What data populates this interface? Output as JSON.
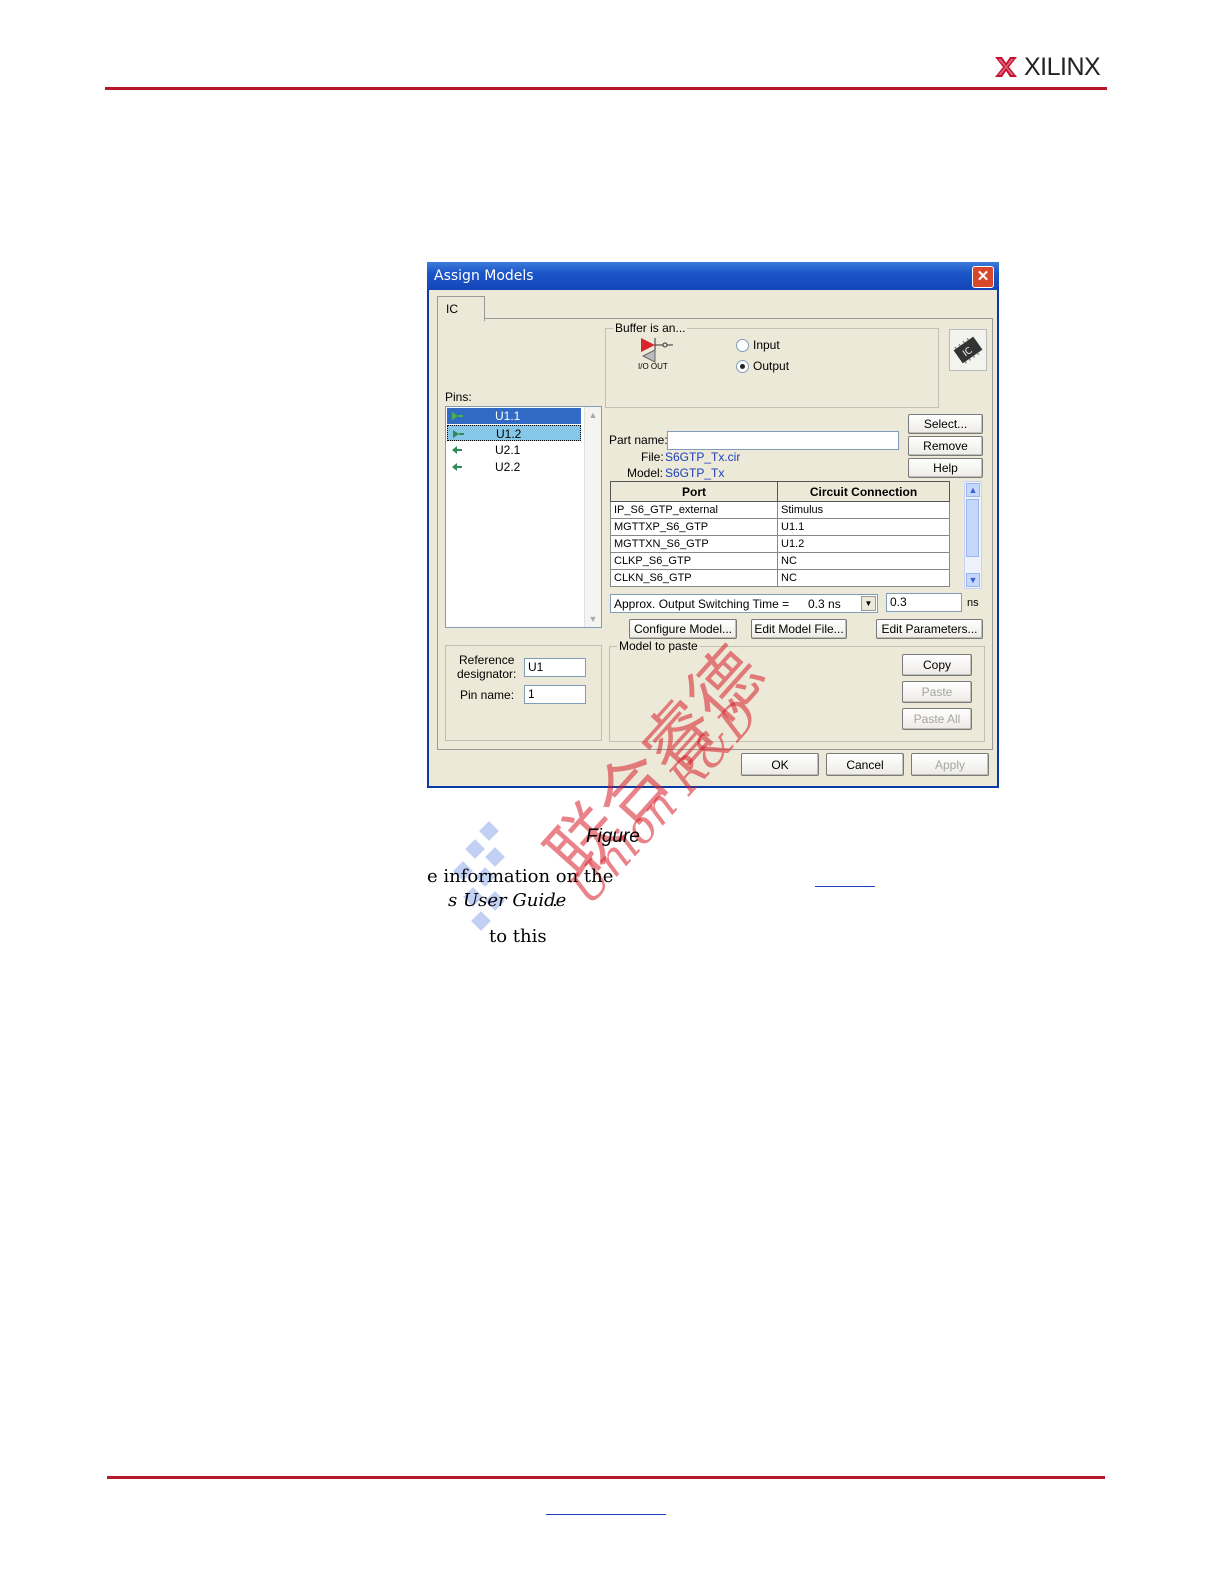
{
  "header": {
    "logo_text": "XILINX"
  },
  "dialog": {
    "title": "Assign Models",
    "tab_label": "IC",
    "buffer_group_title": "Buffer is an...",
    "buffer_pin_labels": "I/O OUT",
    "radio_input_label": "Input",
    "radio_output_label": "Output",
    "radio_selected": "Output",
    "pins_label": "Pins:",
    "pins": [
      "U1.1",
      "U1.2",
      "U2.1",
      "U2.2"
    ],
    "part_name_label": "Part name:",
    "part_name_value": "",
    "file_label": "File:",
    "file_value": "S6GTP_Tx.cir",
    "model_label": "Model:",
    "model_value": "S6GTP_Tx",
    "select_button": "Select...",
    "remove_button": "Remove",
    "help_button": "Help",
    "grid_headers": [
      "Port",
      "Circuit Connection"
    ],
    "grid_rows": [
      [
        "IP_S6_GTP_external",
        "Stimulus"
      ],
      [
        "MGTTXP_S6_GTP",
        "U1.1"
      ],
      [
        "MGTTXN_S6_GTP",
        "U1.2"
      ],
      [
        "CLKP_S6_GTP",
        "NC"
      ],
      [
        "CLKN_S6_GTP",
        "NC"
      ]
    ],
    "switching_label": "Approx. Output Switching Time  =",
    "switching_select": "0.3 ns",
    "switching_value": "0.3",
    "switching_unit": "ns",
    "configure_button": "Configure Model...",
    "edit_model_button": "Edit Model File...",
    "edit_params_button": "Edit Parameters...",
    "model_paste_title": "Model to paste",
    "copy_button": "Copy",
    "paste_button": "Paste",
    "paste_all_button": "Paste All",
    "ref_label_1": "Reference",
    "ref_label_2": "designator:",
    "ref_value": "U1",
    "pin_name_label": "Pin name:",
    "pin_name_value": "1",
    "ok_button": "OK",
    "cancel_button": "Cancel",
    "apply_button": "Apply",
    "icon_badge": "IC"
  },
  "page": {
    "caption": "Figure",
    "line1": "e information on the",
    "line2_italic": "s User Guide",
    "line2_tail": ".",
    "line3": "to this"
  },
  "watermark": {
    "chinese": "联合睿德",
    "english": "Union R&D"
  },
  "colors": {
    "brand_rule": "#b5172b",
    "title_blue": "#1a55c8",
    "link": "#1c3fbb"
  }
}
